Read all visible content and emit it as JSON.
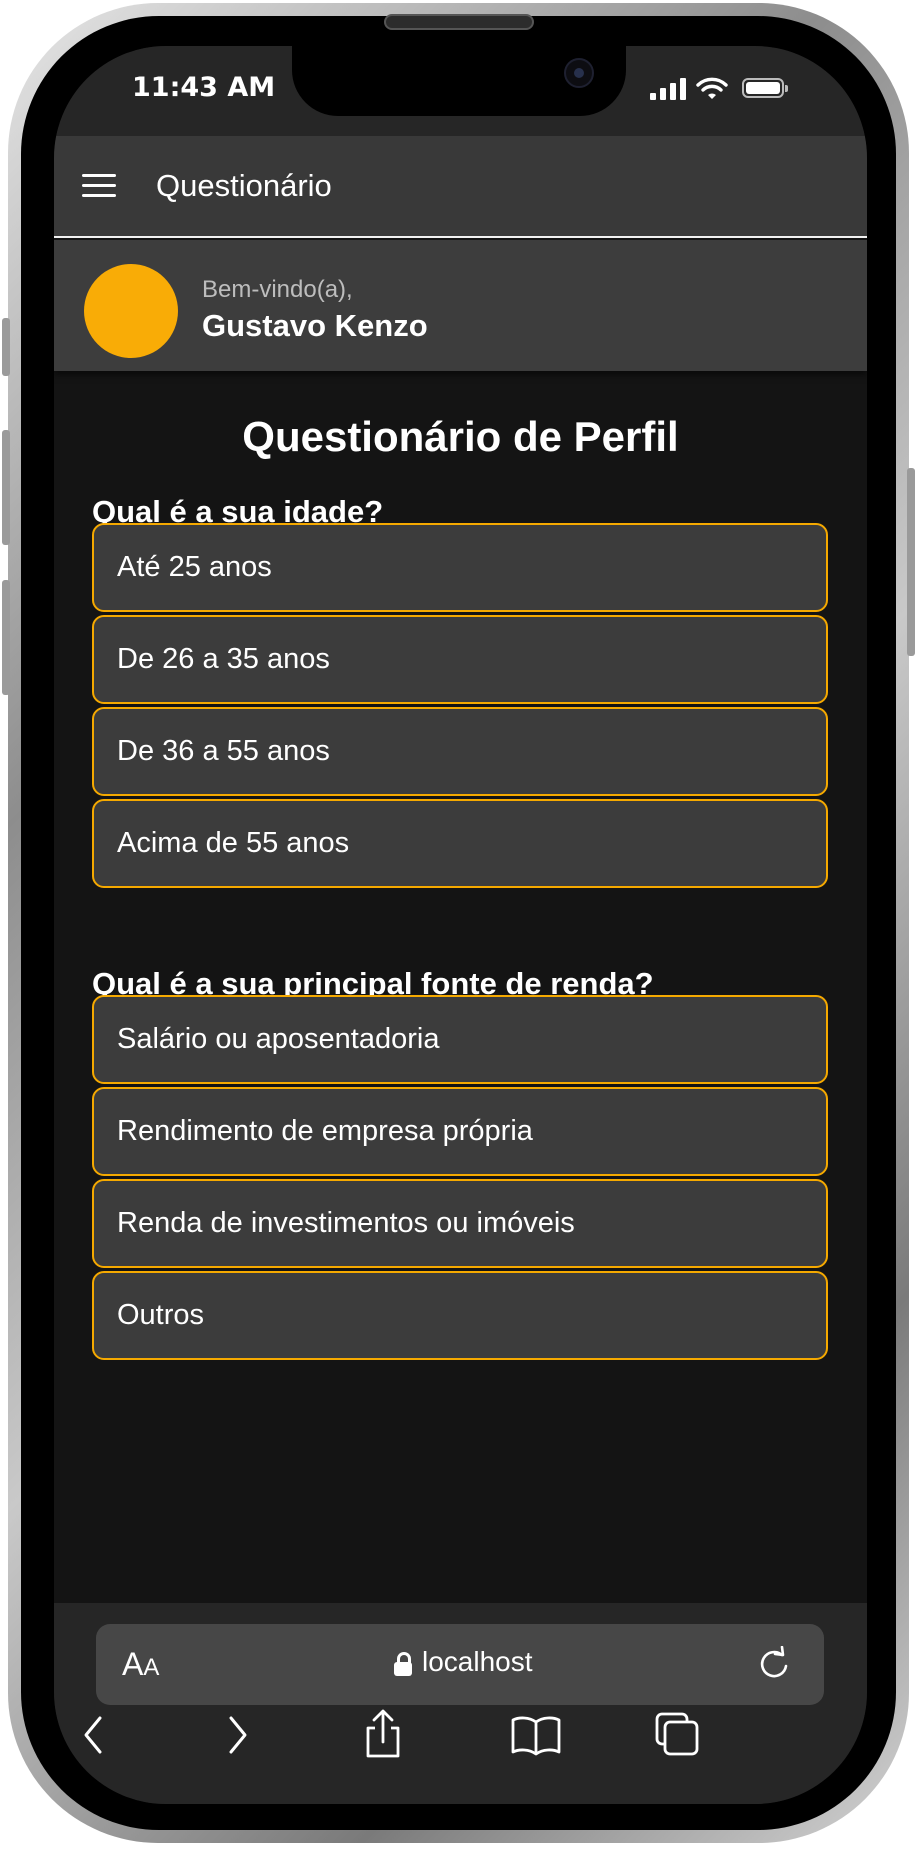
{
  "status_bar": {
    "time": "11:43 AM",
    "icons": [
      "cellular-signal-icon",
      "wifi-icon",
      "battery-icon"
    ]
  },
  "app_bar": {
    "menu_icon": "hamburger-menu-icon",
    "title": "Questionário"
  },
  "user_header": {
    "welcome": "Bem-vindo(a),",
    "name": "Gustavo Kenzo",
    "avatar_color": "#f9ac06"
  },
  "questionnaire": {
    "title": "Questionário de Perfil",
    "questions": [
      {
        "text": "Qual é a sua idade?",
        "options": [
          "Até 25 anos",
          "De 26 a 35 anos",
          "De 36 a 55 anos",
          "Acima de 55 anos"
        ]
      },
      {
        "text": "Qual é a sua principal fonte de renda?",
        "options": [
          "Salário ou aposentadoria",
          "Rendimento de empresa própria",
          "Renda de investimentos ou imóveis",
          "Outros"
        ]
      }
    ]
  },
  "browser": {
    "text_size_big": "A",
    "text_size_small": "A",
    "url": "localhost",
    "toolbar_icons": [
      "back-icon",
      "forward-icon",
      "share-icon",
      "bookmarks-icon",
      "tabs-icon"
    ]
  },
  "colors": {
    "accent": "#f5a900",
    "background": "#141414",
    "app_bar": "#393939",
    "option_background": "#3c3c3c"
  }
}
